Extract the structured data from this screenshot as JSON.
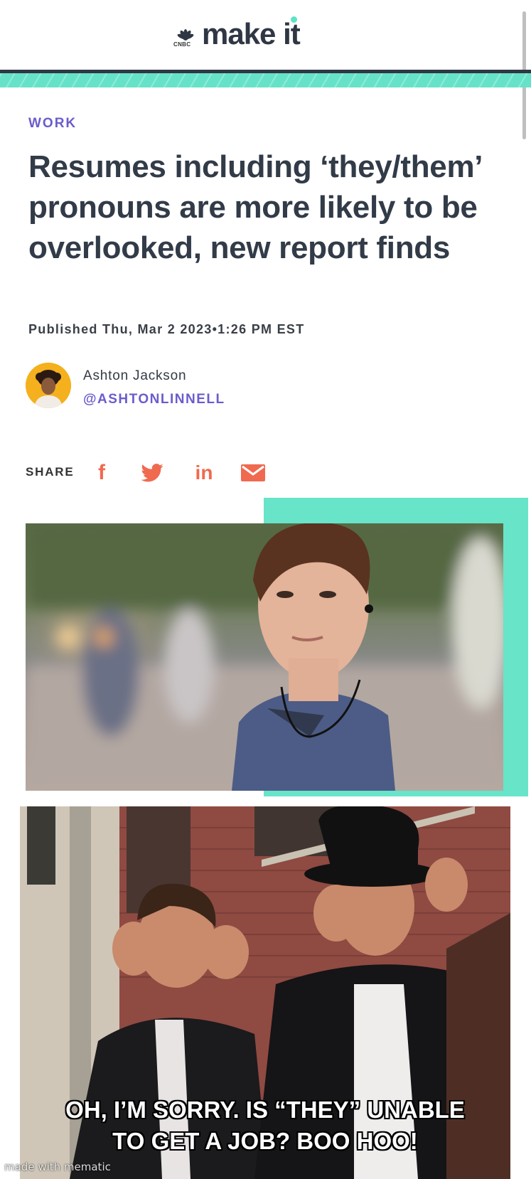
{
  "header": {
    "logo_sub": "CNBC",
    "logo_text": "make it",
    "accent_color": "#66e2c8"
  },
  "article": {
    "category": "WORK",
    "headline": "Resumes including ‘they/them’ pronouns are more likely to be overlooked, new report finds",
    "published": "Published Thu, Mar 2 2023•1:26 PM EST",
    "author": {
      "name": "Ashton Jackson",
      "handle": "@ASHTONLINNELL"
    },
    "share": {
      "label": "SHARE",
      "icons": [
        "facebook-icon",
        "twitter-icon",
        "linkedin-icon",
        "mail-icon"
      ],
      "facebook_glyph": "f",
      "linkedin_glyph": "in"
    },
    "accent_color": "#6a5ccd",
    "share_color": "#f06a50"
  },
  "meme": {
    "caption_line1": "OH, I’M SORRY. IS “THEY” UNABLE",
    "caption_line2": "TO GET A JOB? BOO HOO!",
    "watermark": "made with mematic"
  }
}
